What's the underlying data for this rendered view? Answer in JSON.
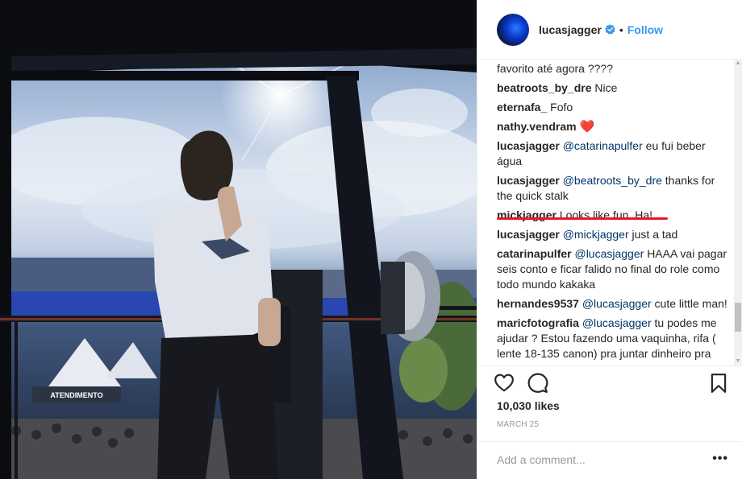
{
  "post": {
    "author": "lucasjagger",
    "follow_label": "Follow",
    "separator": "•",
    "likes": "10,030 likes",
    "date": "MARCH 25",
    "comment_placeholder": "Add a comment...",
    "more_options": "•••"
  },
  "icons": {
    "verified": "verified-badge-icon",
    "like": "heart-outline-icon",
    "comment": "speech-bubble-icon",
    "save": "bookmark-icon",
    "more": "ellipsis-icon"
  },
  "photo_text": {
    "booth_sign": "ATENDIMENTO"
  },
  "comments": [
    {
      "user": "",
      "text": "favorito até agora ????"
    },
    {
      "user": "beatroots_by_dre",
      "text": "Nice"
    },
    {
      "user": "eternafa_",
      "text": "Fofo"
    },
    {
      "user": "nathy.vendram",
      "text": "❤️"
    },
    {
      "user": "lucasjagger",
      "mention": "@catarinapulfer",
      "text": "eu fui beber água"
    },
    {
      "user": "lucasjagger",
      "mention": "@beatroots_by_dre",
      "text": "thanks for the quick stalk"
    },
    {
      "user": "mickjagger",
      "text": "Looks like fun. Ha!"
    },
    {
      "user": "lucasjagger",
      "mention": "@mickjagger",
      "text": "just a tad"
    },
    {
      "user": "catarinapulfer",
      "mention": "@lucasjagger",
      "text": "HAAA vai pagar seis conto e ficar falido no final do role como todo mundo kakaka"
    },
    {
      "user": "hernandes9537",
      "mention": "@lucasjagger",
      "text": "cute little man!"
    },
    {
      "user": "maricfotografia",
      "mention": "@lucasjagger",
      "text": "tu podes me ajudar ? Estou fazendo uma vaquinha, rifa ( lente 18-135 canon) pra juntar dinheiro pra"
    }
  ],
  "colors": {
    "link": "#3897f0",
    "mention": "#003569",
    "highlight_underline": "#e8172e",
    "heart": "#ed4956"
  }
}
